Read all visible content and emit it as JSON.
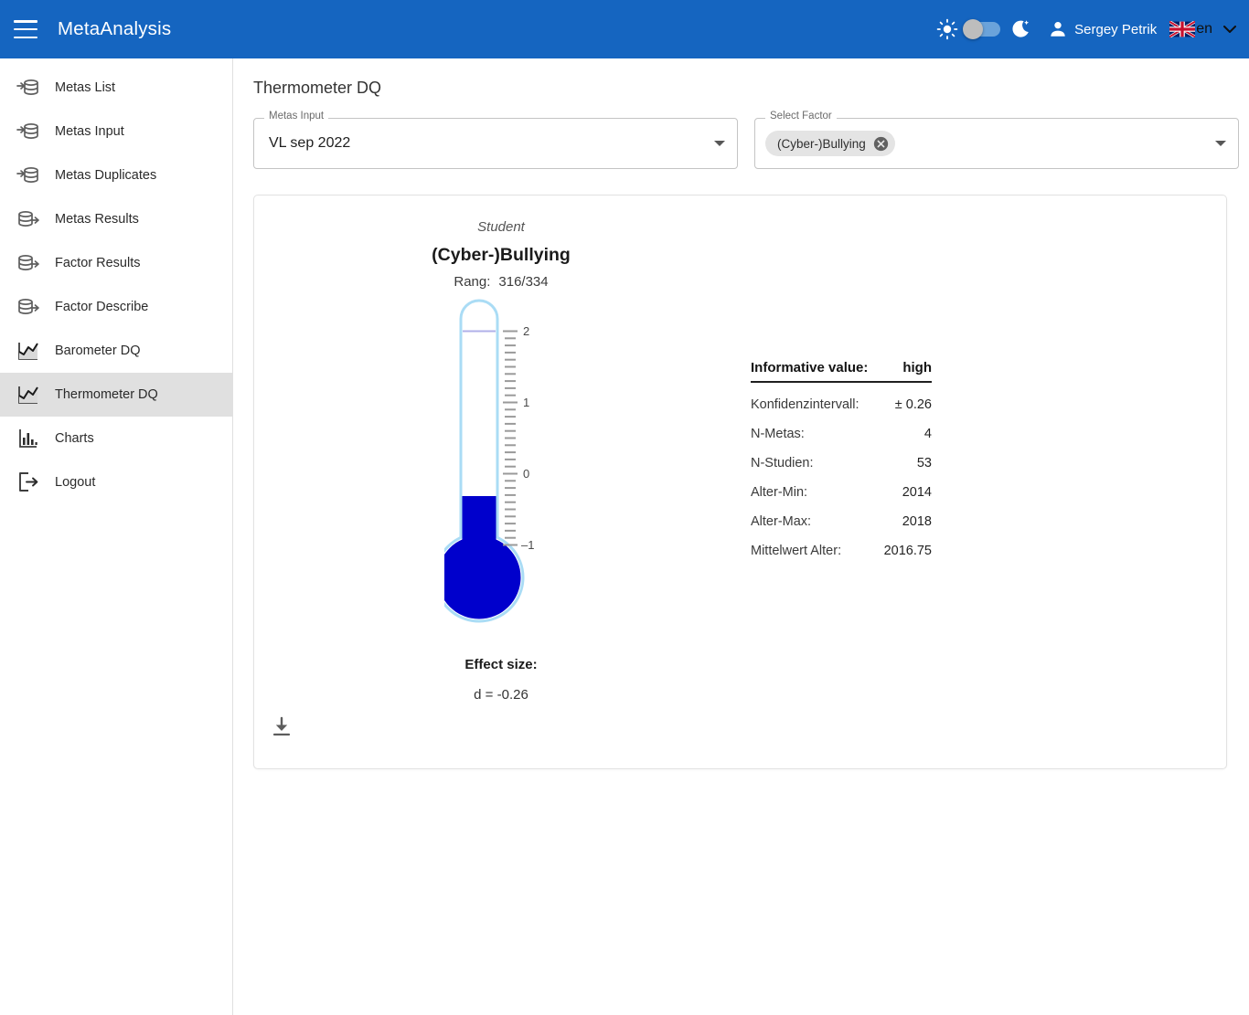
{
  "appbar": {
    "menu_icon": "hamburger-menu-icon",
    "title": "MetaAnalysis",
    "light_icon": "sun-icon",
    "dark_icon": "moon-icon",
    "theme_toggle_state": "off",
    "user_icon": "person-icon",
    "user_name": "Sergey Petrik",
    "language_flag": "uk-flag-icon",
    "language_code": "en",
    "language_chevron": "chevron-down-icon",
    "background_color": "#1565c0"
  },
  "sidebar": {
    "items": [
      {
        "label": "Metas List",
        "icon": "database-import-icon",
        "active": false
      },
      {
        "label": "Metas Input",
        "icon": "database-import-icon",
        "active": false
      },
      {
        "label": "Metas Duplicates",
        "icon": "database-import-icon",
        "active": false
      },
      {
        "label": "Metas Results",
        "icon": "database-export-icon",
        "active": false
      },
      {
        "label": "Factor Results",
        "icon": "database-export-icon",
        "active": false
      },
      {
        "label": "Factor Describe",
        "icon": "database-export-icon",
        "active": false
      },
      {
        "label": "Barometer DQ",
        "icon": "line-chart-icon",
        "active": false
      },
      {
        "label": "Thermometer DQ",
        "icon": "line-chart-icon",
        "active": true
      },
      {
        "label": "Charts",
        "icon": "bar-chart-icon",
        "active": false
      },
      {
        "label": "Logout",
        "icon": "logout-icon",
        "active": false
      }
    ]
  },
  "main": {
    "page_title": "Thermometer DQ",
    "metas_input": {
      "legend": "Metas Input",
      "value": "VL sep 2022",
      "arrow_icon": "dropdown-arrow-icon"
    },
    "select_factor": {
      "legend": "Select Factor",
      "chip_label": "(Cyber-)Bullying",
      "chip_remove_icon": "close-circle-icon",
      "arrow_icon": "dropdown-arrow-icon"
    },
    "download_icon": "download-icon"
  },
  "chart_data": {
    "type": "thermometer",
    "group": "Student",
    "title": "(Cyber-)Bullying",
    "rang_label": "Rang:",
    "rang_value": "316/334",
    "effect_label": "Effect size:",
    "effect_value": "d = -0.26",
    "value": -0.26,
    "axis_min": -1,
    "axis_max": 2,
    "tick_labels": [
      "2",
      "1",
      "0",
      "-1"
    ],
    "tick_values": [
      2,
      1,
      0,
      -1
    ],
    "minor_tick_step": 0.1,
    "reference_line": 2,
    "fill_color": "#0000cc",
    "tube_color": "#aadcf5",
    "reference_line_color": "#b0b0e8",
    "grid": false,
    "legend": "none",
    "info": {
      "header_key": "Informative value:",
      "header_value": "high",
      "rows": [
        {
          "key": "Konfidenzintervall:",
          "value": "± 0.26"
        },
        {
          "key": "N-Metas:",
          "value": "4"
        },
        {
          "key": "N-Studien:",
          "value": "53"
        },
        {
          "key": "Alter-Min:",
          "value": "2014"
        },
        {
          "key": "Alter-Max:",
          "value": "2018"
        },
        {
          "key": "Mittelwert Alter:",
          "value": "2016.75"
        }
      ]
    }
  }
}
